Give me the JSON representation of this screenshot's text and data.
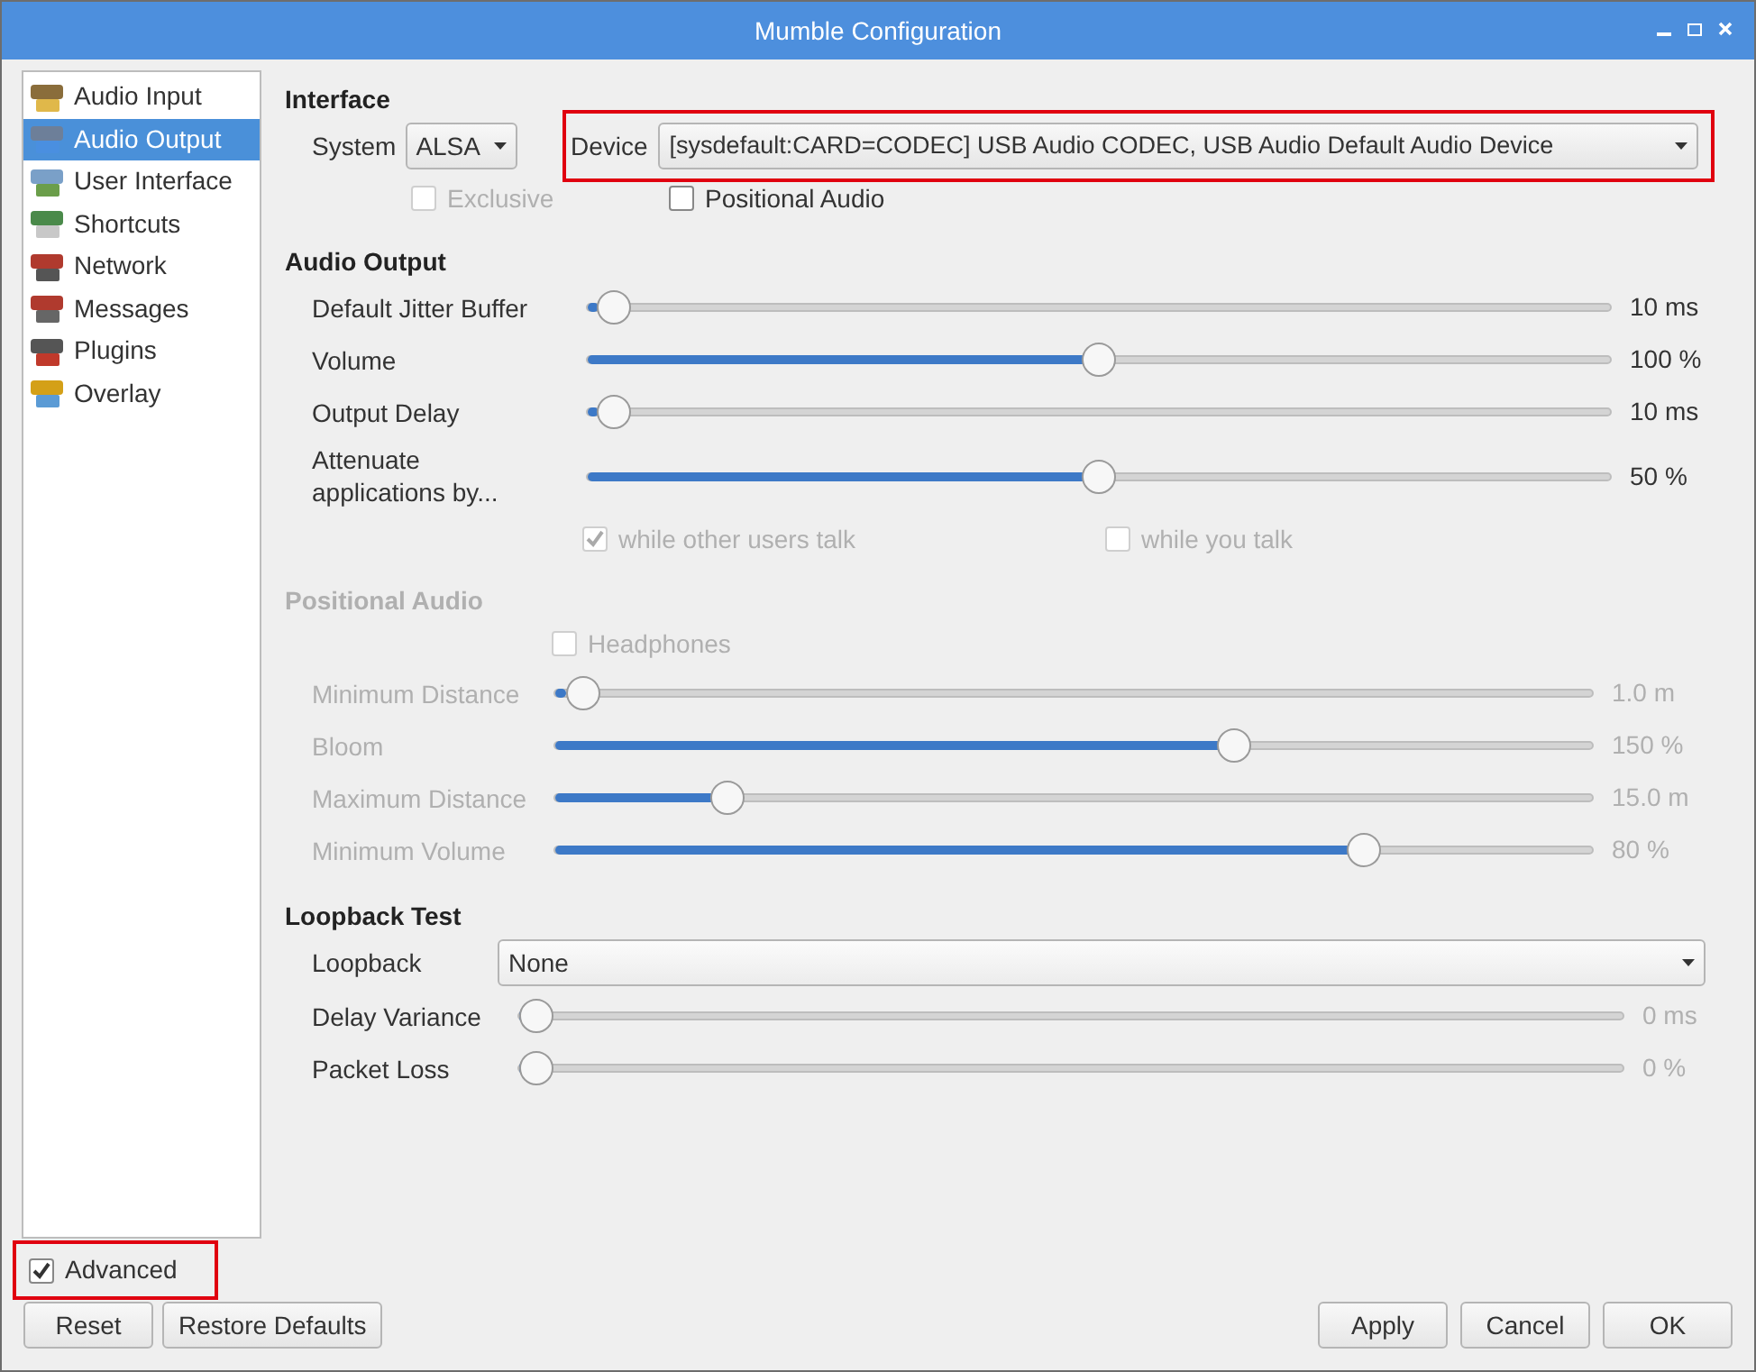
{
  "window": {
    "title": "Mumble Configuration"
  },
  "sidebar": {
    "items": [
      {
        "label": "Audio Input",
        "selected": false
      },
      {
        "label": "Audio Output",
        "selected": true
      },
      {
        "label": "User Interface",
        "selected": false
      },
      {
        "label": "Shortcuts",
        "selected": false
      },
      {
        "label": "Network",
        "selected": false
      },
      {
        "label": "Messages",
        "selected": false
      },
      {
        "label": "Plugins",
        "selected": false
      },
      {
        "label": "Overlay",
        "selected": false
      }
    ]
  },
  "interface": {
    "heading": "Interface",
    "system_label": "System",
    "system_value": "ALSA",
    "device_label": "Device",
    "device_value": "[sysdefault:CARD=CODEC] USB Audio CODEC, USB Audio Default Audio Device",
    "device_highlighted": true,
    "exclusive": {
      "label": "Exclusive",
      "checked": false,
      "disabled": true
    },
    "positional": {
      "label": "Positional Audio",
      "checked": false,
      "disabled": false
    }
  },
  "audio_output": {
    "heading": "Audio Output",
    "disabled": false,
    "sliders": [
      {
        "label": "Default Jitter Buffer",
        "level": 0.01,
        "reading": "10 ms"
      },
      {
        "label": "Volume",
        "level": 0.5,
        "reading": "100 %"
      },
      {
        "label": "Output Delay",
        "level": 0.01,
        "reading": "10 ms"
      },
      {
        "label": "Attenuate applications by...",
        "level": 0.5,
        "reading": "50 %"
      }
    ],
    "checks": [
      {
        "label": "while other users talk",
        "checked": true,
        "disabled": true
      },
      {
        "label": "while you talk",
        "checked": false,
        "disabled": true
      }
    ]
  },
  "positional_audio": {
    "heading": "Positional Audio",
    "disabled": true,
    "headphones": {
      "label": "Headphones",
      "checked": false,
      "disabled": true
    },
    "sliders": [
      {
        "label": "Minimum Distance",
        "level": 0.01,
        "reading": "1.0 m"
      },
      {
        "label": "Bloom",
        "level": 0.66,
        "reading": "150 %"
      },
      {
        "label": "Maximum Distance",
        "level": 0.155,
        "reading": "15.0 m"
      },
      {
        "label": "Minimum Volume",
        "level": 0.79,
        "reading": "80 %"
      }
    ]
  },
  "loopback_test": {
    "heading": "Loopback Test",
    "loopback_label": "Loopback",
    "loopback_value": "None",
    "sliders": [
      {
        "label": "Delay Variance",
        "level": 0.0,
        "reading": "0 ms",
        "disabled": true
      },
      {
        "label": "Packet Loss",
        "level": 0.0,
        "reading": "0 %",
        "disabled": true
      }
    ]
  },
  "advanced": {
    "label": "Advanced",
    "checked": true,
    "highlighted": true
  },
  "buttons_left": [
    "Reset",
    "Restore Defaults"
  ],
  "buttons_right": [
    "Apply",
    "Cancel",
    "OK"
  ]
}
